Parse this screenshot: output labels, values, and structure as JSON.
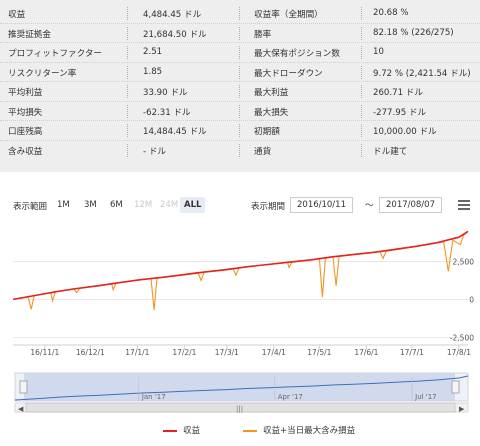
{
  "stats": {
    "rows": [
      {
        "label1": "収益",
        "help1": false,
        "value1": "4,484.45 ドル",
        "label2": "収益率（全期間）",
        "help2": true,
        "value2": "20.68 %"
      },
      {
        "label1": "推奨証拠金",
        "help1": true,
        "value1": "21,684.50 ドル",
        "label2": "勝率",
        "help2": false,
        "value2": "82.18 % (226/275)"
      },
      {
        "label1": "プロフィットファクター",
        "help1": false,
        "value1": "2.51",
        "label2": "最大保有ポジション数",
        "help2": true,
        "value2": "10"
      },
      {
        "label1": "リスクリターン率",
        "help1": true,
        "value1": "1.85",
        "label2": "最大ドローダウン",
        "help2": true,
        "value2": "9.72 % (2,421.54 ドル)"
      },
      {
        "label1": "平均利益",
        "help1": false,
        "value1": "33.90 ドル",
        "label2": "最大利益",
        "help2": false,
        "value2": "260.71 ドル"
      },
      {
        "label1": "平均損失",
        "help1": false,
        "value1": "-62.31 ドル",
        "label2": "最大損失",
        "help2": false,
        "value2": "-277.95 ドル"
      },
      {
        "label1": "口座残高",
        "help1": false,
        "value1": "14,484.45 ドル",
        "label2": "初期額",
        "help2": true,
        "value2": "10,000.00 ドル"
      },
      {
        "label1": "含み収益",
        "help1": false,
        "value1": "- ドル",
        "label2": "通貨",
        "help2": false,
        "value2": "ドル建て"
      }
    ],
    "help_glyph": "?"
  },
  "toolbar": {
    "range_label": "表示範囲",
    "ranges": [
      {
        "label": "1M",
        "state": "normal"
      },
      {
        "label": "3M",
        "state": "normal"
      },
      {
        "label": "6M",
        "state": "normal"
      },
      {
        "label": "12M",
        "state": "disabled"
      },
      {
        "label": "24M",
        "state": "disabled"
      },
      {
        "label": "ALL",
        "state": "active"
      }
    ],
    "period_label": "表示期間",
    "from_date": "2016/10/11",
    "tilde": "～",
    "to_date": "2017/08/07",
    "menu_icon": "hamburger-menu-icon"
  },
  "chart_data": {
    "type": "line",
    "x_tick_labels": [
      "16/11/1",
      "16/12/1",
      "17/1/1",
      "17/2/1",
      "17/3/1",
      "17/4/1",
      "17/5/1",
      "17/6/1",
      "17/7/1",
      "17/8/1"
    ],
    "x_ticks": [
      "2016-11-01",
      "2016-12-01",
      "2017-01-01",
      "2017-02-01",
      "2017-03-01",
      "2017-04-01",
      "2017-05-01",
      "2017-06-01",
      "2017-07-01",
      "2017-08-01"
    ],
    "y_ticks": [
      -2500,
      0,
      2500
    ],
    "y_tick_labels": [
      "-2,500",
      "0",
      "2,500"
    ],
    "ylim": [
      -3000,
      4900
    ],
    "xlim": [
      "2016-10-11",
      "2017-08-07"
    ],
    "series": [
      {
        "name": "収益",
        "color": "#e32222",
        "points": [
          [
            "2016-10-11",
            0
          ],
          [
            "2016-10-25",
            250
          ],
          [
            "2016-11-08",
            500
          ],
          [
            "2016-11-22",
            720
          ],
          [
            "2016-12-06",
            900
          ],
          [
            "2016-12-20",
            1100
          ],
          [
            "2017-01-03",
            1300
          ],
          [
            "2017-01-17",
            1450
          ],
          [
            "2017-01-31",
            1620
          ],
          [
            "2017-02-14",
            1800
          ],
          [
            "2017-02-28",
            1950
          ],
          [
            "2017-03-14",
            2150
          ],
          [
            "2017-03-28",
            2300
          ],
          [
            "2017-04-11",
            2450
          ],
          [
            "2017-04-25",
            2600
          ],
          [
            "2017-05-09",
            2800
          ],
          [
            "2017-05-23",
            2950
          ],
          [
            "2017-06-06",
            3100
          ],
          [
            "2017-06-20",
            3300
          ],
          [
            "2017-07-04",
            3500
          ],
          [
            "2017-07-18",
            3750
          ],
          [
            "2017-08-01",
            4100
          ],
          [
            "2017-08-07",
            4480
          ]
        ]
      },
      {
        "name": "収益+当日最大含み損益",
        "color": "#f7931e",
        "points": [
          [
            "2016-10-11",
            0
          ],
          [
            "2016-10-21",
            150
          ],
          [
            "2016-10-23",
            -650
          ],
          [
            "2016-10-25",
            250
          ],
          [
            "2016-11-05",
            450
          ],
          [
            "2016-11-06",
            -100
          ],
          [
            "2016-11-08",
            500
          ],
          [
            "2016-11-20",
            700
          ],
          [
            "2016-11-22",
            450
          ],
          [
            "2016-11-24",
            720
          ],
          [
            "2016-12-15",
            1050
          ],
          [
            "2016-12-16",
            650
          ],
          [
            "2016-12-18",
            1080
          ],
          [
            "2017-01-10",
            1380
          ],
          [
            "2017-01-12",
            -700
          ],
          [
            "2017-01-14",
            1410
          ],
          [
            "2017-02-10",
            1780
          ],
          [
            "2017-02-12",
            1250
          ],
          [
            "2017-02-14",
            1800
          ],
          [
            "2017-03-05",
            2050
          ],
          [
            "2017-03-07",
            1600
          ],
          [
            "2017-03-09",
            2080
          ],
          [
            "2017-04-10",
            2440
          ],
          [
            "2017-04-11",
            2100
          ],
          [
            "2017-04-13",
            2460
          ],
          [
            "2017-05-01",
            2660
          ],
          [
            "2017-05-03",
            150
          ],
          [
            "2017-05-05",
            2700
          ],
          [
            "2017-05-10",
            2810
          ],
          [
            "2017-05-12",
            900
          ],
          [
            "2017-05-14",
            2830
          ],
          [
            "2017-06-10",
            3150
          ],
          [
            "2017-06-12",
            2700
          ],
          [
            "2017-06-14",
            3170
          ],
          [
            "2017-07-22",
            3780
          ],
          [
            "2017-07-25",
            1850
          ],
          [
            "2017-07-28",
            3900
          ],
          [
            "2017-08-02",
            3600
          ],
          [
            "2017-08-04",
            4200
          ],
          [
            "2017-08-07",
            4480
          ]
        ]
      }
    ],
    "navigator": {
      "labels": [
        "Jan '17",
        "Apr '17",
        "Jul '17"
      ],
      "label_dates": [
        "2017-01-01",
        "2017-04-01",
        "2017-07-01"
      ]
    }
  },
  "legend": {
    "items": [
      {
        "label": "収益",
        "color": "#e32222"
      },
      {
        "label": "収益+当日最大含み損益",
        "color": "#f7931e"
      }
    ]
  }
}
